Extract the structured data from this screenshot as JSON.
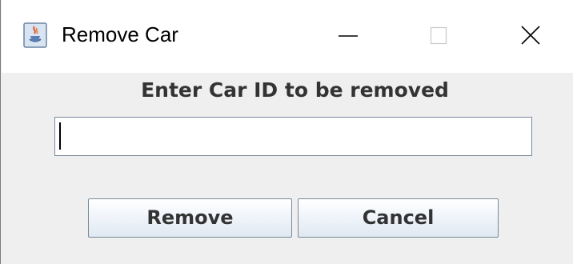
{
  "window": {
    "title": "Remove Car",
    "app_icon": "java-coffee-cup-icon",
    "controls": {
      "minimize_icon": "minimize-icon",
      "maximize_icon": "maximize-icon",
      "close_icon": "close-icon"
    }
  },
  "dialog": {
    "prompt": "Enter Car ID to be removed",
    "car_id_value": "",
    "remove_label": "Remove",
    "cancel_label": "Cancel"
  },
  "colors": {
    "dialog_background": "#efefef",
    "titlebar_background": "#ffffff",
    "text": "#333333"
  }
}
